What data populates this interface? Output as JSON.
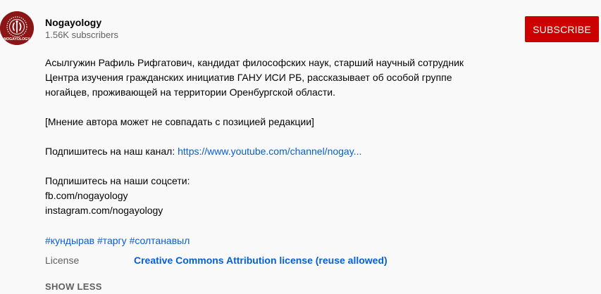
{
  "channel": {
    "name": "Nogayology",
    "subscribers": "1.56K subscribers",
    "avatar_text": "NOGAYOLOGY"
  },
  "subscribe_label": "SUBSCRIBE",
  "description": {
    "para1": [
      "Асылгужин Рафиль Рифгатович, кандидат философских наук, старший научный сотрудник",
      "Центра изучения гражданских инициатив ГАНУ ИСИ РБ, рассказывает об особой группе",
      "ногайцев, проживающей на территории Оренбургской области."
    ],
    "disclaimer": "[Мнение автора может не совпадать с позицией редакции]",
    "subscribe_prompt": "Подпишитесь на наш канал: ",
    "channel_link": "https://www.youtube.com/channel/nogay...",
    "social_heading": "Подпишитесь на наши соцсети:",
    "social_fb": "fb.com/nogayology",
    "social_instagram": "instagram.com/nogayology"
  },
  "hashtags": [
    "#кундырав",
    "#таргу",
    "#солтанавыл"
  ],
  "license": {
    "label": "License",
    "value": "Creative Commons Attribution license (reuse allowed)"
  },
  "show_less": "SHOW LESS",
  "colors": {
    "subscribe_bg": "#cc0000",
    "link": "#065fd4",
    "avatar_bg": "#8b1616"
  }
}
